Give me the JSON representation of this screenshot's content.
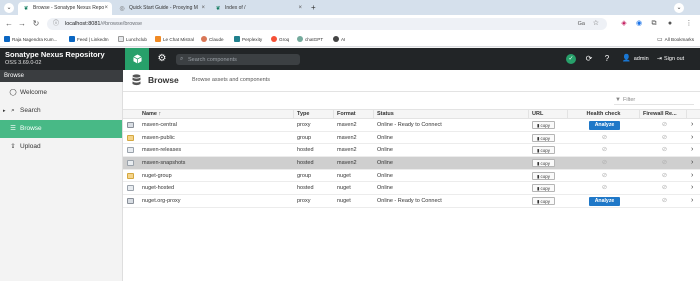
{
  "browser": {
    "tabs": [
      {
        "label": "Browse - Sonatype Nexus Repo",
        "active": true
      },
      {
        "label": "Quick Start Guide - Proxying M",
        "active": false
      },
      {
        "label": "Index of /",
        "active": false
      }
    ],
    "url_host": "localhost:8081",
    "url_path": "/#browse/browse",
    "bookmarks": [
      {
        "label": "Raja Nagendra Kum...",
        "color": "#0a66c2"
      },
      {
        "label": "Feed | LinkedIn",
        "color": "#0a66c2"
      },
      {
        "label": "Lunchclub",
        "color": "#e8eaed"
      },
      {
        "label": "Le Chat Mistral",
        "color": "#f08a24"
      },
      {
        "label": "Claude",
        "color": "#d97757"
      },
      {
        "label": "Perplexity",
        "color": "#20808d"
      },
      {
        "label": "Groq",
        "color": "#f55036"
      },
      {
        "label": "chatGPT",
        "color": "#74aa9c"
      },
      {
        "label": "AI",
        "color": "#444444"
      }
    ],
    "all_bookmarks": "All Bookmarks"
  },
  "header": {
    "product_name": "Sonatype Nexus Repository",
    "version": "OSS 3.69.0-02",
    "search_placeholder": "Search components",
    "username": "admin",
    "signout_label": "Sign out"
  },
  "sidebar": {
    "title": "Browse",
    "items": [
      {
        "label": "Welcome",
        "icon": "welcome-icon",
        "active": false
      },
      {
        "label": "Search",
        "icon": "search-icon",
        "active": false
      },
      {
        "label": "Browse",
        "icon": "database-icon",
        "active": true
      },
      {
        "label": "Upload",
        "icon": "upload-icon",
        "active": false
      }
    ]
  },
  "page": {
    "title": "Browse",
    "subtitle": "Browse assets and components",
    "filter_placeholder": "Filter"
  },
  "table": {
    "columns": [
      "Name ↑",
      "Type",
      "Format",
      "Status",
      "URL",
      "Health check",
      "Firewall Re..."
    ],
    "copy_label": "copy",
    "analyze_label": "Analyze",
    "rows": [
      {
        "name": "maven-central",
        "type": "proxy",
        "format": "maven2",
        "status": "Online - Ready to Connect",
        "health": "analyze",
        "selected": false
      },
      {
        "name": "maven-public",
        "type": "group",
        "format": "maven2",
        "status": "Online",
        "health": "none",
        "selected": false
      },
      {
        "name": "maven-releases",
        "type": "hosted",
        "format": "maven2",
        "status": "Online",
        "health": "none",
        "selected": false
      },
      {
        "name": "maven-snapshots",
        "type": "hosted",
        "format": "maven2",
        "status": "Online",
        "health": "none",
        "selected": true
      },
      {
        "name": "nuget-group",
        "type": "group",
        "format": "nuget",
        "status": "Online",
        "health": "none",
        "selected": false
      },
      {
        "name": "nuget-hosted",
        "type": "hosted",
        "format": "nuget",
        "status": "Online",
        "health": "none",
        "selected": false
      },
      {
        "name": "nuget.org-proxy",
        "type": "proxy",
        "format": "nuget",
        "status": "Online - Ready to Connect",
        "health": "analyze",
        "selected": false
      }
    ]
  },
  "colors": {
    "header_bg": "#222527",
    "accent_green": "#27a06a",
    "sidebar_active": "#48b986",
    "analyze_blue": "#1f78c8"
  }
}
